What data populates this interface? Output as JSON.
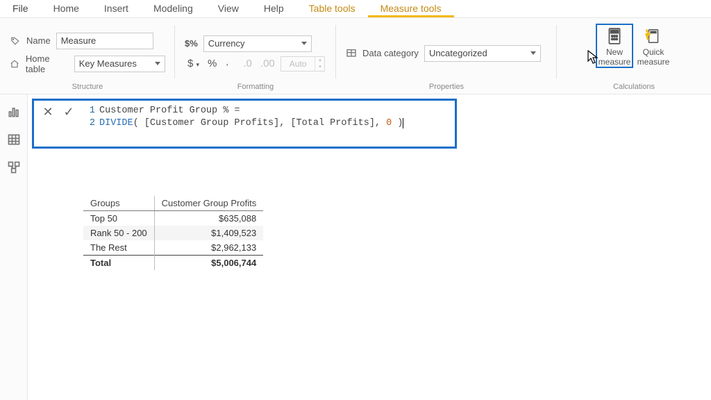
{
  "tabs": {
    "file": "File",
    "home": "Home",
    "insert": "Insert",
    "modeling": "Modeling",
    "view": "View",
    "help": "Help",
    "table_tools": "Table tools",
    "measure_tools": "Measure tools"
  },
  "ribbon": {
    "structure": {
      "label": "Structure",
      "name_label": "Name",
      "name_value": "Measure",
      "home_table_label": "Home table",
      "home_table_value": "Key Measures"
    },
    "formatting": {
      "label": "Formatting",
      "format_value": "Currency",
      "decimals_value": "Auto",
      "dollar": "$",
      "percent": "%",
      "comma": ",",
      "decimals_icon_a": ".0",
      "decimals_icon_b": ".00",
      "currency_prefix": "$%"
    },
    "properties": {
      "label": "Properties",
      "data_category_label": "Data category",
      "data_category_value": "Uncategorized"
    },
    "calculations": {
      "label": "Calculations",
      "new_measure": "New measure",
      "quick_measure": "Quick measure"
    }
  },
  "formula": {
    "line1_num": "1",
    "line1_text": "Customer Profit Group % =",
    "line2_num": "2",
    "line2_fn": "DIVIDE",
    "line2_rest_a": "( [Customer Group Profits], [Total Profits], ",
    "line2_lit": "0",
    "line2_rest_b": " )"
  },
  "table": {
    "headers": {
      "groups": "Groups",
      "cgp": "Customer Group Profits"
    },
    "rows": [
      {
        "label": "Top 50",
        "value": "$635,088"
      },
      {
        "label": "Rank 50 - 200",
        "value": "$1,409,523"
      },
      {
        "label": "The Rest",
        "value": "$2,962,133"
      }
    ],
    "total": {
      "label": "Total",
      "value": "$5,006,744"
    }
  }
}
